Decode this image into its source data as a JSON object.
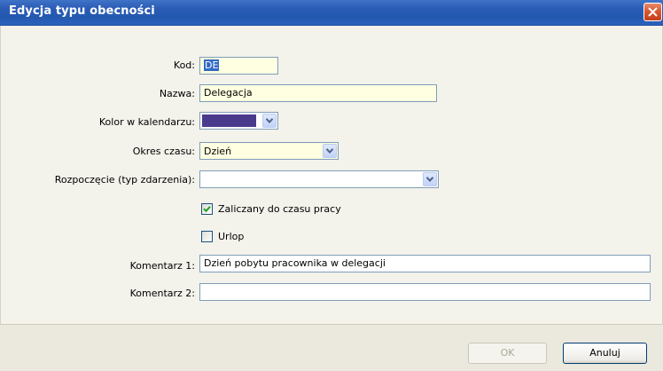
{
  "window": {
    "title": "Edycja typu obecności"
  },
  "form": {
    "kod": {
      "label": "Kod:",
      "value": "DE"
    },
    "nazwa": {
      "label": "Nazwa:",
      "value": "Delegacja"
    },
    "kolor": {
      "label": "Kolor w kalendarzu:",
      "color": "#4a3a8c"
    },
    "okres": {
      "label": "Okres czasu:",
      "value": "Dzień"
    },
    "rozpoczecie": {
      "label": "Rozpoczęcie (typ zdarzenia):",
      "value": ""
    },
    "zaliczany": {
      "label": "Zaliczany do czasu pracy",
      "checked": true
    },
    "urlop": {
      "label": "Urlop",
      "checked": false
    },
    "komentarz1": {
      "label": "Komentarz 1:",
      "value": "Dzień pobytu pracownika w delegacji"
    },
    "komentarz2": {
      "label": "Komentarz 2:",
      "value": ""
    }
  },
  "buttons": {
    "ok": "OK",
    "cancel": "Anuluj"
  },
  "icons": {
    "close": "close-icon",
    "dropdown": "chevron-down-icon",
    "check": "checkmark-icon"
  }
}
